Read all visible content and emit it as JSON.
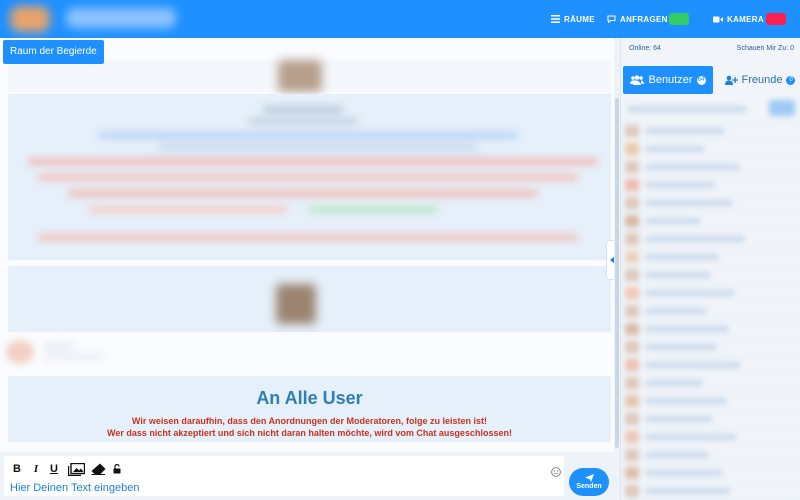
{
  "header": {
    "nav": {
      "rooms_label": "RÄUME",
      "requests_label": "ANFRAGEN",
      "camera_label": "KAMERA"
    },
    "colors": {
      "bar": "#1e90ff",
      "requests_toggle": "#33cc66",
      "camera_toggle": "#ff1f4d"
    }
  },
  "chat": {
    "room_name": "Raum der Begierde",
    "notice": {
      "title": "An Alle User",
      "line1": "Wir weisen daraufhin, dass den Anordnungen der Moderatoren, folge zu leisten ist!",
      "line2": "Wer dass nicht akzeptiert und sich nicht daran halten möchte, wird vom Chat ausgeschlossen!"
    }
  },
  "composer": {
    "bold": "B",
    "italic": "I",
    "underline": "U",
    "placeholder": "Hier Deinen Text eingeben",
    "send_label": "Senden"
  },
  "sidebar": {
    "online_label": "Online: 64",
    "watching_label": "Schauen Mir Zu: 0",
    "tabs": {
      "users_label": "Benutzer",
      "users_count": "64",
      "friends_label": "Freunde",
      "friends_count": "0"
    }
  }
}
